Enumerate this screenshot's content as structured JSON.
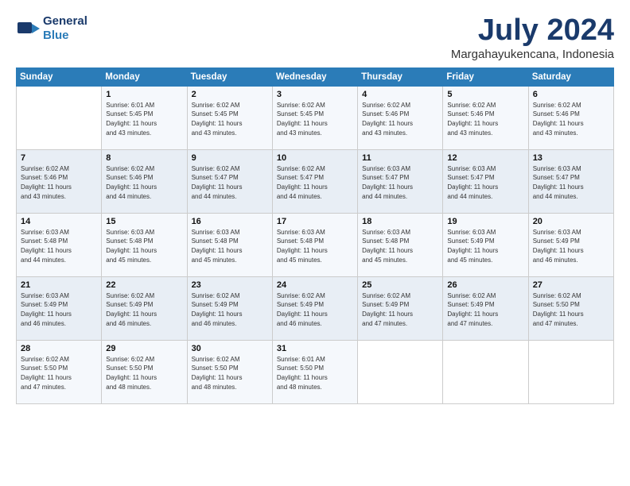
{
  "header": {
    "logo_general": "General",
    "logo_blue": "Blue",
    "month_title": "July 2024",
    "location": "Margahayukencana, Indonesia"
  },
  "weekdays": [
    "Sunday",
    "Monday",
    "Tuesday",
    "Wednesday",
    "Thursday",
    "Friday",
    "Saturday"
  ],
  "weeks": [
    [
      {
        "num": "",
        "info": ""
      },
      {
        "num": "1",
        "info": "Sunrise: 6:01 AM\nSunset: 5:45 PM\nDaylight: 11 hours\nand 43 minutes."
      },
      {
        "num": "2",
        "info": "Sunrise: 6:02 AM\nSunset: 5:45 PM\nDaylight: 11 hours\nand 43 minutes."
      },
      {
        "num": "3",
        "info": "Sunrise: 6:02 AM\nSunset: 5:45 PM\nDaylight: 11 hours\nand 43 minutes."
      },
      {
        "num": "4",
        "info": "Sunrise: 6:02 AM\nSunset: 5:46 PM\nDaylight: 11 hours\nand 43 minutes."
      },
      {
        "num": "5",
        "info": "Sunrise: 6:02 AM\nSunset: 5:46 PM\nDaylight: 11 hours\nand 43 minutes."
      },
      {
        "num": "6",
        "info": "Sunrise: 6:02 AM\nSunset: 5:46 PM\nDaylight: 11 hours\nand 43 minutes."
      }
    ],
    [
      {
        "num": "7",
        "info": "Sunrise: 6:02 AM\nSunset: 5:46 PM\nDaylight: 11 hours\nand 43 minutes."
      },
      {
        "num": "8",
        "info": "Sunrise: 6:02 AM\nSunset: 5:46 PM\nDaylight: 11 hours\nand 44 minutes."
      },
      {
        "num": "9",
        "info": "Sunrise: 6:02 AM\nSunset: 5:47 PM\nDaylight: 11 hours\nand 44 minutes."
      },
      {
        "num": "10",
        "info": "Sunrise: 6:02 AM\nSunset: 5:47 PM\nDaylight: 11 hours\nand 44 minutes."
      },
      {
        "num": "11",
        "info": "Sunrise: 6:03 AM\nSunset: 5:47 PM\nDaylight: 11 hours\nand 44 minutes."
      },
      {
        "num": "12",
        "info": "Sunrise: 6:03 AM\nSunset: 5:47 PM\nDaylight: 11 hours\nand 44 minutes."
      },
      {
        "num": "13",
        "info": "Sunrise: 6:03 AM\nSunset: 5:47 PM\nDaylight: 11 hours\nand 44 minutes."
      }
    ],
    [
      {
        "num": "14",
        "info": "Sunrise: 6:03 AM\nSunset: 5:48 PM\nDaylight: 11 hours\nand 44 minutes."
      },
      {
        "num": "15",
        "info": "Sunrise: 6:03 AM\nSunset: 5:48 PM\nDaylight: 11 hours\nand 45 minutes."
      },
      {
        "num": "16",
        "info": "Sunrise: 6:03 AM\nSunset: 5:48 PM\nDaylight: 11 hours\nand 45 minutes."
      },
      {
        "num": "17",
        "info": "Sunrise: 6:03 AM\nSunset: 5:48 PM\nDaylight: 11 hours\nand 45 minutes."
      },
      {
        "num": "18",
        "info": "Sunrise: 6:03 AM\nSunset: 5:48 PM\nDaylight: 11 hours\nand 45 minutes."
      },
      {
        "num": "19",
        "info": "Sunrise: 6:03 AM\nSunset: 5:49 PM\nDaylight: 11 hours\nand 45 minutes."
      },
      {
        "num": "20",
        "info": "Sunrise: 6:03 AM\nSunset: 5:49 PM\nDaylight: 11 hours\nand 46 minutes."
      }
    ],
    [
      {
        "num": "21",
        "info": "Sunrise: 6:03 AM\nSunset: 5:49 PM\nDaylight: 11 hours\nand 46 minutes."
      },
      {
        "num": "22",
        "info": "Sunrise: 6:02 AM\nSunset: 5:49 PM\nDaylight: 11 hours\nand 46 minutes."
      },
      {
        "num": "23",
        "info": "Sunrise: 6:02 AM\nSunset: 5:49 PM\nDaylight: 11 hours\nand 46 minutes."
      },
      {
        "num": "24",
        "info": "Sunrise: 6:02 AM\nSunset: 5:49 PM\nDaylight: 11 hours\nand 46 minutes."
      },
      {
        "num": "25",
        "info": "Sunrise: 6:02 AM\nSunset: 5:49 PM\nDaylight: 11 hours\nand 47 minutes."
      },
      {
        "num": "26",
        "info": "Sunrise: 6:02 AM\nSunset: 5:49 PM\nDaylight: 11 hours\nand 47 minutes."
      },
      {
        "num": "27",
        "info": "Sunrise: 6:02 AM\nSunset: 5:50 PM\nDaylight: 11 hours\nand 47 minutes."
      }
    ],
    [
      {
        "num": "28",
        "info": "Sunrise: 6:02 AM\nSunset: 5:50 PM\nDaylight: 11 hours\nand 47 minutes."
      },
      {
        "num": "29",
        "info": "Sunrise: 6:02 AM\nSunset: 5:50 PM\nDaylight: 11 hours\nand 48 minutes."
      },
      {
        "num": "30",
        "info": "Sunrise: 6:02 AM\nSunset: 5:50 PM\nDaylight: 11 hours\nand 48 minutes."
      },
      {
        "num": "31",
        "info": "Sunrise: 6:01 AM\nSunset: 5:50 PM\nDaylight: 11 hours\nand 48 minutes."
      },
      {
        "num": "",
        "info": ""
      },
      {
        "num": "",
        "info": ""
      },
      {
        "num": "",
        "info": ""
      }
    ]
  ]
}
